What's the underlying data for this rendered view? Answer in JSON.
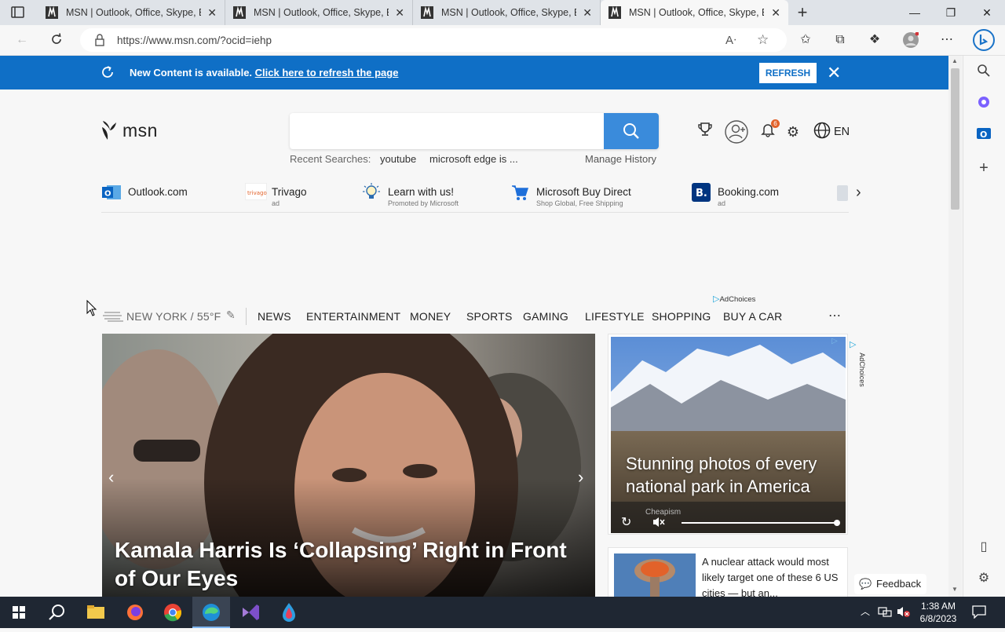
{
  "browser": {
    "tabs": [
      {
        "title": "MSN | Outlook, Office, Skype, Bing",
        "active": false
      },
      {
        "title": "MSN | Outlook, Office, Skype, Bing",
        "active": false
      },
      {
        "title": "MSN | Outlook, Office, Skype, Bing",
        "active": false
      },
      {
        "title": "MSN | Outlook, Office, Skype, Bing",
        "active": true
      }
    ],
    "url": "https://www.msn.com/?ocid=iehp"
  },
  "banner": {
    "text": "New Content is available.",
    "link": "Click here to refresh the page",
    "button": "REFRESH"
  },
  "msn": {
    "logo_text": "msn",
    "search_placeholder": "",
    "recent_label": "Recent Searches:",
    "recent_items": [
      "youtube",
      "microsoft edge is ..."
    ],
    "manage_history": "Manage History",
    "notification_count": "6",
    "language": "EN"
  },
  "quick_links": [
    {
      "label": "Outlook.com",
      "sub": ""
    },
    {
      "label": "Trivago",
      "sub": "ad"
    },
    {
      "label": "Learn with us!",
      "sub": "Promoted by Microsoft"
    },
    {
      "label": "Microsoft Buy Direct",
      "sub": "Shop Global, Free Shipping"
    },
    {
      "label": "Booking.com",
      "sub": "ad"
    }
  ],
  "adchoices_label": "AdChoices",
  "weather": "NEW YORK / 55°F",
  "nav": [
    "NEWS",
    "ENTERTAINMENT",
    "MONEY",
    "SPORTS",
    "GAMING",
    "LIFESTYLE",
    "SHOPPING",
    "BUY A CAR"
  ],
  "hero": {
    "title": "Kamala Harris Is ‘Collapsing’ Right in Front of Our Eyes"
  },
  "ad": {
    "caption": "Stunning photos of every national park in America",
    "source": "Cheapism",
    "adchoices": "AdChoices"
  },
  "news_card": {
    "text": "A nuclear attack would most likely target one of these 6 US cities — but an..."
  },
  "feedback": "Feedback",
  "clock": {
    "time": "1:38 AM",
    "date": "6/8/2023"
  },
  "colors": {
    "banner": "#0f6fc6",
    "search_button": "#3a8bdb",
    "taskbar": "#1f2733"
  }
}
